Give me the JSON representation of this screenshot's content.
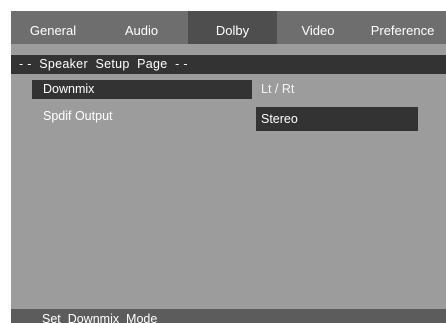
{
  "tabs": {
    "general": "General",
    "audio": "Audio",
    "dolby": "Dolby",
    "video": "Video",
    "preference": "Preference",
    "selected": "dolby"
  },
  "page_title": "- -  Speaker  Setup  Page  - -",
  "settings": {
    "downmix": {
      "label": "Downmix",
      "value": "Lt / Rt"
    },
    "spdif_output": {
      "label": "Spdif Output",
      "value": "Stereo"
    }
  },
  "status_text": "Set  Downmix  Mode",
  "colors": {
    "panel": "#9c9c9c",
    "tab_bar": "#6e6e6e",
    "tab_selected": "#4e4e4e",
    "highlight": "#333333",
    "status_bar": "#5c5c5c",
    "text": "#ffffff"
  }
}
